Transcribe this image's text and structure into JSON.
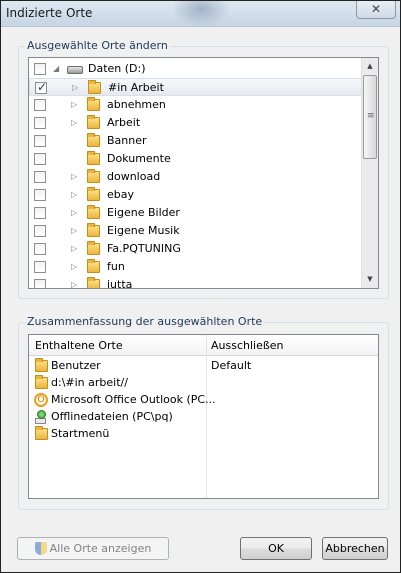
{
  "window": {
    "title": "Indizierte Orte",
    "close_glyph": "✕"
  },
  "locations_group": {
    "label": "Ausgewählte Orte ändern",
    "tree": [
      {
        "label": "Daten (D:)",
        "icon": "drive-icon",
        "checked": false,
        "expander": "◢",
        "level": 0
      },
      {
        "label": "#in Arbeit",
        "icon": "folder-icon",
        "checked": true,
        "expander": "▷",
        "level": 1,
        "selected": true
      },
      {
        "label": "abnehmen",
        "icon": "folder-icon",
        "checked": false,
        "expander": "▷",
        "level": 1
      },
      {
        "label": "Arbeit",
        "icon": "folder-icon",
        "checked": false,
        "expander": "▷",
        "level": 1
      },
      {
        "label": "Banner",
        "icon": "folder-icon",
        "checked": false,
        "expander": "",
        "level": 1
      },
      {
        "label": "Dokumente",
        "icon": "folder-icon",
        "checked": false,
        "expander": "",
        "level": 1
      },
      {
        "label": "download",
        "icon": "folder-icon",
        "checked": false,
        "expander": "▷",
        "level": 1
      },
      {
        "label": "ebay",
        "icon": "folder-icon",
        "checked": false,
        "expander": "▷",
        "level": 1
      },
      {
        "label": "Eigene Bilder",
        "icon": "folder-icon",
        "checked": false,
        "expander": "▷",
        "level": 1
      },
      {
        "label": "Eigene Musik",
        "icon": "folder-icon",
        "checked": false,
        "expander": "▷",
        "level": 1
      },
      {
        "label": "Fa.PQTUNING",
        "icon": "folder-icon",
        "checked": false,
        "expander": "▷",
        "level": 1
      },
      {
        "label": "fun",
        "icon": "folder-icon",
        "checked": false,
        "expander": "▷",
        "level": 1
      },
      {
        "label": "jutta",
        "icon": "folder-icon",
        "checked": false,
        "expander": "▷",
        "level": 1
      }
    ],
    "scroll_up_glyph": "▲",
    "scroll_down_glyph": "▼",
    "thumb_grip": "≡"
  },
  "summary_group": {
    "label": "Zusammenfassung der ausgewählten Orte",
    "columns": {
      "included": "Enthaltene Orte",
      "excluded": "Ausschließen"
    },
    "rows": [
      {
        "name": "Benutzer",
        "exclude": "Default",
        "icon": "folder-icon"
      },
      {
        "name": "d:\\#in arbeit//",
        "exclude": "",
        "icon": "folder-icon"
      },
      {
        "name": "Microsoft Office Outlook (PC...",
        "exclude": "",
        "icon": "outlook-icon"
      },
      {
        "name": "Offlinedateien (PC\\pq)",
        "exclude": "",
        "icon": "offline-files-icon"
      },
      {
        "name": "Startmenü",
        "exclude": "",
        "icon": "folder-icon"
      }
    ]
  },
  "buttons": {
    "show_all": "Alle Orte anzeigen",
    "ok": "OK",
    "cancel": "Abbrechen"
  }
}
